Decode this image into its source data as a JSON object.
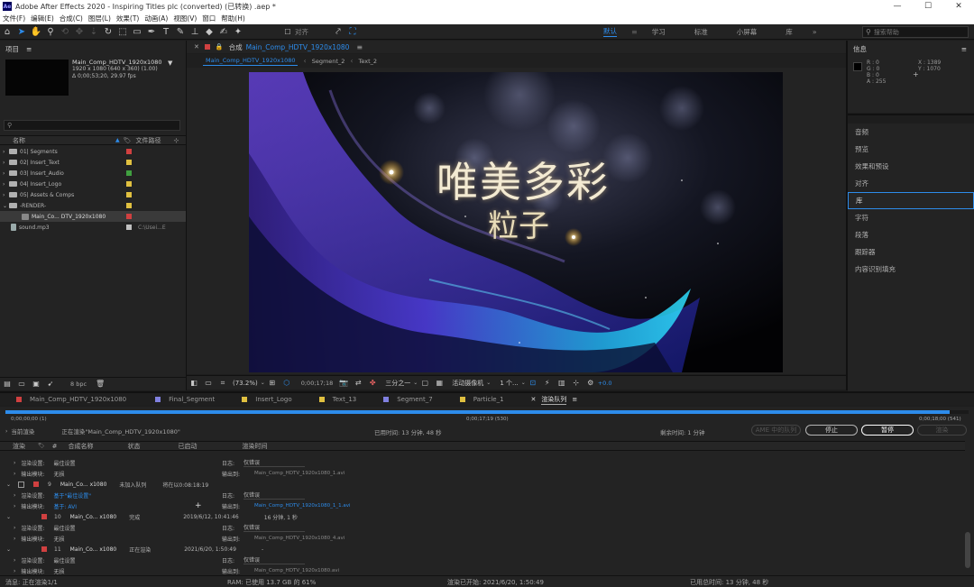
{
  "titlebar": {
    "app_logo": "Ae",
    "title": "Adobe After Effects 2020 - Inspiring Titles plc (converted) (已转换) .aep *"
  },
  "menu": [
    "文件(F)",
    "编辑(E)",
    "合成(C)",
    "图层(L)",
    "效果(T)",
    "动画(A)",
    "视图(V)",
    "窗口",
    "帮助(H)"
  ],
  "toolbar": {
    "align_label": "对齐",
    "workspaces": [
      "默认",
      "学习",
      "标准",
      "小屏幕",
      "库"
    ],
    "search_placeholder": "搜索帮助"
  },
  "project": {
    "title": "项目",
    "comp_name": "Main_Comp_HDTV_1920x1080",
    "comp_info1": "1920 x 1080  (640 x 360) (1.00)",
    "comp_info2": "Δ 0;00;53;20, 29.97 fps",
    "col_name": "名称",
    "col_path": "文件路径",
    "items": [
      {
        "label": "01| Segments",
        "color": "#d04040"
      },
      {
        "label": "02| Insert_Text",
        "color": "#e0c040"
      },
      {
        "label": "03| Insert_Audio",
        "color": "#40a040"
      },
      {
        "label": "04| Insert_Logo",
        "color": "#e0c040"
      },
      {
        "label": "05| Assets & Comps",
        "color": "#e0c040"
      },
      {
        "label": "-RENDER-",
        "color": "#e0c040"
      },
      {
        "label": "Main_Co... DTV_1920x1080",
        "color": "#d04040"
      },
      {
        "label": "sound.mp3",
        "color": "#c0c0c0",
        "path": "C:\\Usei...E"
      }
    ],
    "bpc": "8 bpc"
  },
  "viewer": {
    "header_label": "合成",
    "header_comp": "Main_Comp_HDTV_1920x1080",
    "breadcrumbs": [
      "Main_Comp_HDTV_1920x1080",
      "Segment_2",
      "Text_2"
    ],
    "title_main": "唯美多彩",
    "title_sub": "粒子",
    "zoom": "(73.2%)",
    "timecode": "0;00;17;18",
    "resolution": "三分之一",
    "camera": "活动摄像机",
    "views": "1 个...",
    "exposure": "+0.0"
  },
  "info": {
    "title": "信息",
    "r": "R : 0",
    "g": "G : 0",
    "b": "B : 0",
    "a": "A : 255",
    "x": "X : 1389",
    "y": "Y : 1070"
  },
  "right_panels": [
    "音频",
    "预览",
    "效果和预设",
    "对齐",
    "库",
    "字符",
    "段落",
    "跟踪器",
    "内容识别填充"
  ],
  "right_selected": 4,
  "timeline_tabs": [
    {
      "label": "Main_Comp_HDTV_1920x1080",
      "color": "#d04040"
    },
    {
      "label": "Final_Segment",
      "color": "#8080e0"
    },
    {
      "label": "Insert_Logo",
      "color": "#e0c040"
    },
    {
      "label": "Text_13",
      "color": "#e0c040"
    },
    {
      "label": "Segment_7",
      "color": "#8080e0"
    },
    {
      "label": "Particle_1",
      "color": "#e0c040"
    },
    {
      "label": "渲染队列",
      "color": ""
    }
  ],
  "render": {
    "time_start": "0;00;00;00 (1)",
    "time_current": "0;00;17;19 (530)",
    "time_end": "0;00;18;00 (541)",
    "progress": 0.98,
    "current_label": "当前渲染",
    "rendering_text": "正在渲染\"Main_Comp_HDTV_1920x1080\"",
    "elapsed": "已用时间:  13 分钟, 48 秒",
    "remaining": "剩余时间: 1 分钟",
    "ame_btn": "AME 中的队列",
    "stop_btn": "停止",
    "pause_btn": "暂停",
    "render_btn": "渲染",
    "cols": [
      "渲染",
      "#",
      "合成名称",
      "状态",
      "已启动",
      "渲染时间"
    ],
    "rows": [
      {
        "type": "setting",
        "label": "渲染设置:",
        "value": "最佳设置",
        "log_label": "日志:",
        "log": "仅错误"
      },
      {
        "type": "output",
        "label": "输出模块:",
        "value": "无损",
        "out_label": "输出到:",
        "out": "Main_Comp_HDTV_1920x1080_1.avi"
      },
      {
        "type": "item",
        "num": "9",
        "comp": "Main_Co... x1080",
        "status": "未加入队列",
        "started": "将在以0:08:18:19"
      },
      {
        "type": "setting",
        "label": "渲染设置:",
        "value": "基于\"最佳设置\"",
        "log_label": "日志:",
        "log": "仅错误"
      },
      {
        "type": "output",
        "label": "输出模块:",
        "value": "基于: AVI",
        "out_label": "输出到:",
        "out": "Main_Comp_HDTV_1920x1080_1_1.avi"
      },
      {
        "type": "item",
        "num": "10",
        "comp": "Main_Co... x1080",
        "status": "完成",
        "started": "2019/6/12, 10:41:46",
        "time": "16 分钟, 1 秒"
      },
      {
        "type": "setting",
        "label": "渲染设置:",
        "value": "最佳设置",
        "log_label": "日志:",
        "log": "仅错误"
      },
      {
        "type": "output",
        "label": "输出模块:",
        "value": "无损",
        "out_label": "输出到:",
        "out": "Main_Comp_HDTV_1920x1080_4.avi"
      },
      {
        "type": "item",
        "num": "11",
        "comp": "Main_Co... x1080",
        "status": "正在渲染",
        "started": "2021/6/20, 1:50:49",
        "time": "-"
      },
      {
        "type": "setting",
        "label": "渲染设置:",
        "value": "最佳设置",
        "log_label": "日志:",
        "log": "仅错误"
      },
      {
        "type": "output",
        "label": "输出模块:",
        "value": "无损",
        "out_label": "输出到:",
        "out": "Main_Comp_HDTV_1920x1080.avi"
      }
    ]
  },
  "status": {
    "message": "消息: 正在渲染1/1",
    "ram": "RAM: 已使用 13.7 GB 的 61%",
    "render_start": "渲染已开始: 2021/6/20, 1:50:49",
    "total_time": "已用总时间: 13 分钟, 48 秒"
  },
  "colors": {
    "accent": "#2d8ceb",
    "panel": "#232323",
    "bg": "#1d1d1d"
  }
}
